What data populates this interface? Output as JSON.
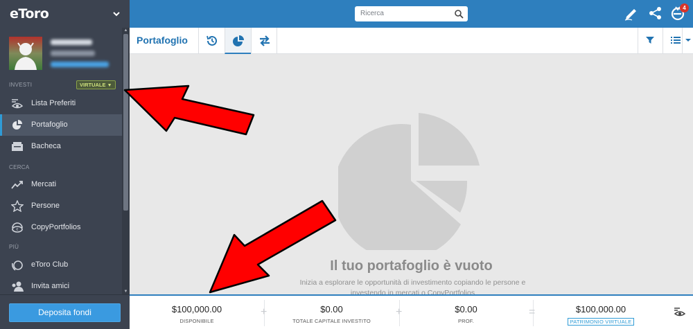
{
  "app": {
    "logo": "eToro"
  },
  "header": {
    "search_placeholder": "Ricerca",
    "notification_count": "4"
  },
  "sidebar": {
    "section_investi": "INVESTI",
    "virtual_badge": "VIRTUALE",
    "items": [
      {
        "label": "Lista Preferiti",
        "icon": "eye-list-icon"
      },
      {
        "label": "Portafoglio",
        "icon": "pie-chart-icon"
      },
      {
        "label": "Bacheca",
        "icon": "news-feed-icon"
      }
    ],
    "section_cerca": "CERCA",
    "cerca_items": [
      {
        "label": "Mercati",
        "icon": "trend-up-icon"
      },
      {
        "label": "Persone",
        "icon": "star-icon"
      },
      {
        "label": "CopyPortfolios",
        "icon": "copyportfolio-icon"
      }
    ],
    "section_piu": "PIÙ",
    "piu_items": [
      {
        "label": "eToro Club",
        "icon": "club-icon"
      },
      {
        "label": "Invita amici",
        "icon": "invite-friends-icon"
      }
    ],
    "deposit_label": "Deposita fondi"
  },
  "page": {
    "title": "Portafoglio",
    "empty_title": "Il tuo portafoglio è vuoto",
    "empty_desc": "Inizia a esplorare le opportunità di investimento copiando le persone e investendo in mercati o CopyPortfolios"
  },
  "footer": {
    "available_value": "$100,000.00",
    "available_label": "DISPONIBILE",
    "invested_value": "$0.00",
    "invested_label": "TOTALE CAPITALE INVESTITO",
    "profit_value": "$0.00",
    "profit_label": "PROF.",
    "equity_value": "$100,000.00",
    "equity_label": "PATRIMONIO VIRTUALE",
    "op_plus_1": "+",
    "op_plus_2": "+",
    "op_equals": "="
  },
  "colors": {
    "sidebar_bg": "#3c4350",
    "topbar_bg": "#2e7fbe",
    "accent": "#2f9bd6",
    "arrow_red": "#ff0000"
  }
}
